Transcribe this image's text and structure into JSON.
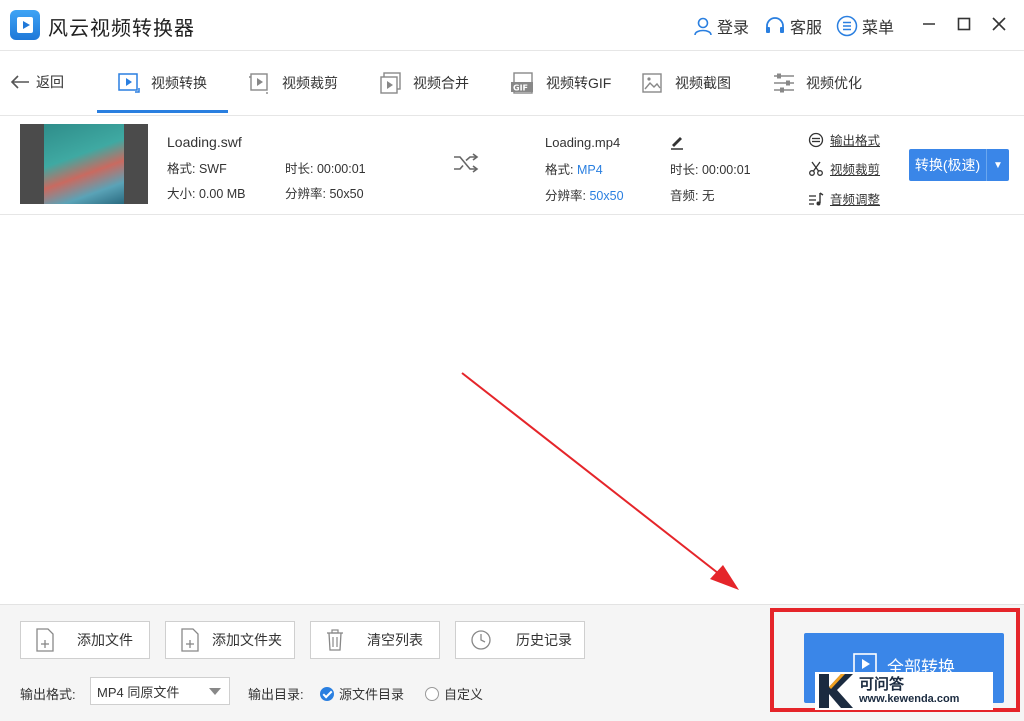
{
  "app": {
    "title": "风云视频转换器"
  },
  "header": {
    "login": "登录",
    "service": "客服",
    "menu": "菜单"
  },
  "nav": {
    "back": "返回",
    "tabs": [
      {
        "label": "视频转换"
      },
      {
        "label": "视频裁剪"
      },
      {
        "label": "视频合并"
      },
      {
        "label": "视频转GIF"
      },
      {
        "label": "视频截图"
      },
      {
        "label": "视频优化"
      }
    ]
  },
  "file": {
    "source": {
      "name": "Loading.swf",
      "format_label": "格式:",
      "format": "SWF",
      "duration_label": "时长:",
      "duration": "00:00:01",
      "size_label": "大小:",
      "size": "0.00 MB",
      "resolution_label": "分辨率:",
      "resolution": "50x50"
    },
    "output": {
      "name": "Loading.mp4",
      "format_label": "格式:",
      "format": "MP4",
      "duration_label": "时长:",
      "duration": "00:00:01",
      "resolution_label": "分辨率:",
      "resolution": "50x50",
      "audio_label": "音频:",
      "audio": "无"
    },
    "actions": {
      "output_format": "输出格式",
      "crop": "视频裁剪",
      "audio": "音频调整"
    },
    "convert_button": "转换(极速)"
  },
  "bottom": {
    "add_file": "添加文件",
    "add_folder": "添加文件夹",
    "clear_list": "清空列表",
    "history": "历史记录",
    "output_format_label": "输出格式:",
    "output_format_value": "MP4 同原文件",
    "output_dir_label": "输出目录:",
    "dir_source": "源文件目录",
    "dir_custom": "自定义",
    "convert_all": "全部转换"
  },
  "watermark": {
    "title": "可问答",
    "url": "www.kewenda.com",
    "logo_letter": "K"
  },
  "colors": {
    "accent": "#3a86e8",
    "highlight": "#e5252a"
  }
}
